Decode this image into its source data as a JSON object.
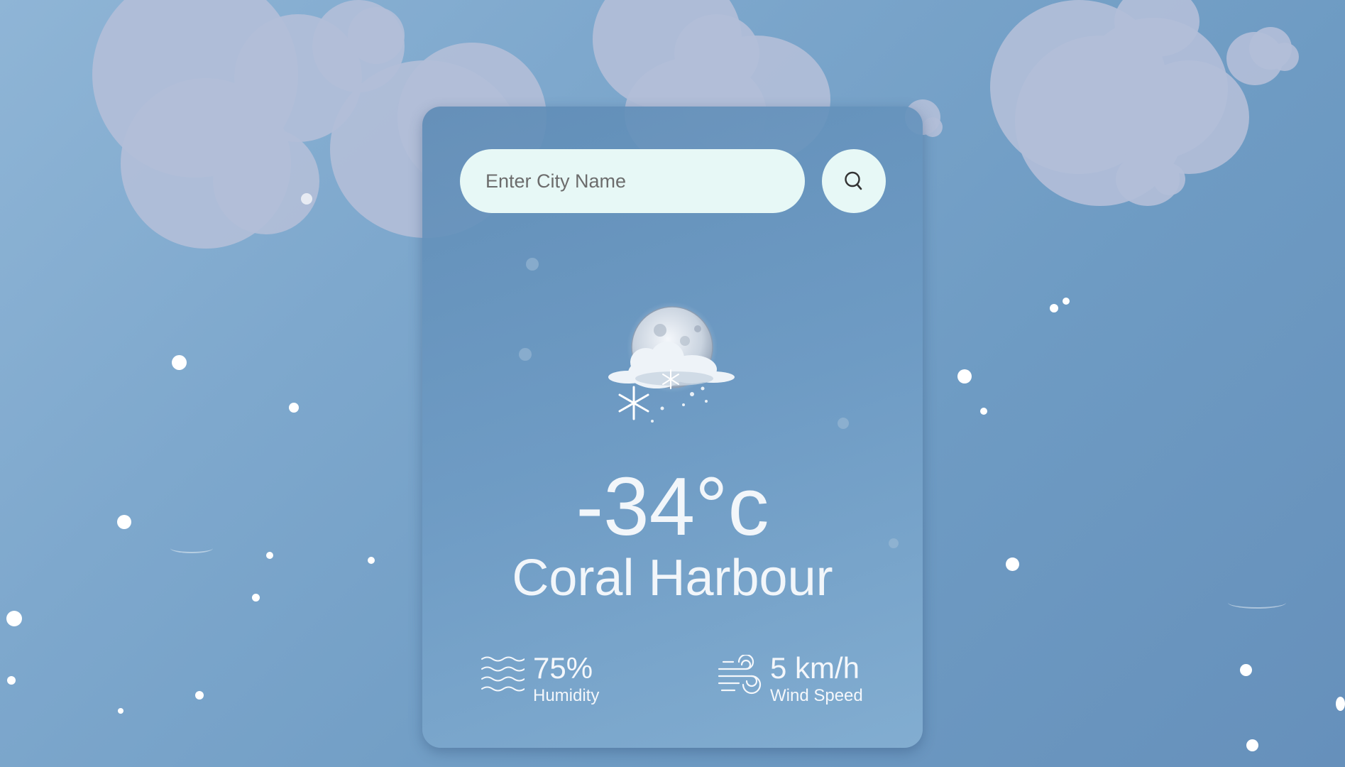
{
  "search": {
    "placeholder": "Enter City Name",
    "button_icon": "search-icon"
  },
  "weather": {
    "icon": "snowy-night-icon",
    "temperature": "-34°c",
    "city": "Coral Harbour"
  },
  "details": {
    "humidity": {
      "icon": "humidity-waves-icon",
      "value": "75%",
      "label": "Humidity"
    },
    "wind": {
      "icon": "wind-icon",
      "value": "5 km/h",
      "label": "Wind Speed"
    }
  },
  "colors": {
    "background": "#7ea8cd",
    "card": "#6e9bc3",
    "input": "#e7f8f6",
    "text": "#f2f6fa",
    "cloud": "#b2bed8"
  }
}
